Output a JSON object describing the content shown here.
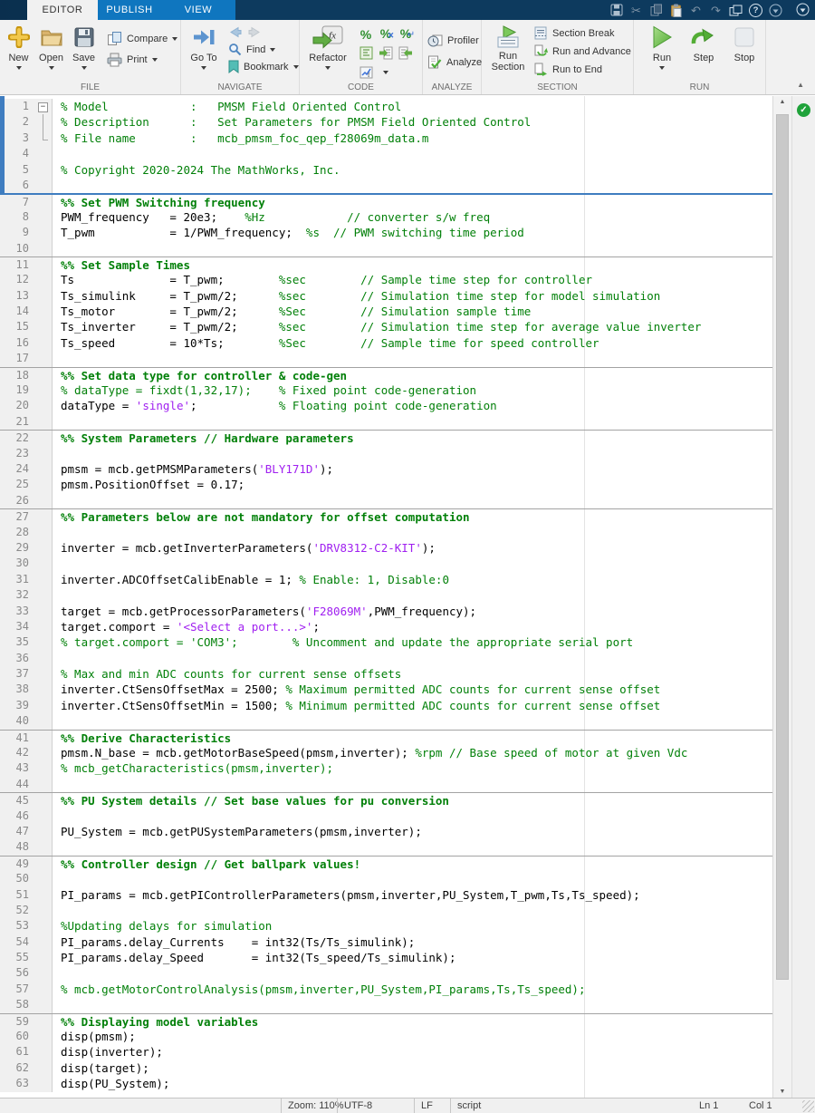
{
  "titlebar": {
    "tabs": [
      {
        "label": "EDITOR",
        "active": true
      },
      {
        "label": "PUBLISH",
        "active": false
      },
      {
        "label": "VIEW",
        "active": false
      }
    ],
    "quick_icons": [
      "save-icon",
      "cut-icon",
      "copy-icon",
      "paste-icon",
      "undo-icon",
      "redo-icon",
      "windows-icon",
      "help-icon",
      "dropdown-icon"
    ],
    "corner_icon": "dropdown-icon"
  },
  "ribbon": {
    "file": {
      "label": "FILE",
      "new": "New",
      "open": "Open",
      "save": "Save",
      "compare": "Compare",
      "print": "Print"
    },
    "navigate": {
      "label": "NAVIGATE",
      "goto": "Go To",
      "find": "Find",
      "bookmark": "Bookmark"
    },
    "code": {
      "label": "CODE",
      "refactor": "Refactor"
    },
    "analyze": {
      "label": "ANALYZE",
      "profiler": "Profiler",
      "analyze": "Analyze"
    },
    "section": {
      "label": "SECTION",
      "run_section_1": "Run",
      "run_section_2": "Section",
      "section_break": "Section Break",
      "run_and_advance": "Run and Advance",
      "run_to_end": "Run to End"
    },
    "run": {
      "label": "RUN",
      "run": "Run",
      "step": "Step",
      "stop": "Stop"
    }
  },
  "colors": {
    "titlebar_navy": "#0d3a5e",
    "tab_blue": "#0f76bf",
    "comment_green": "#028009",
    "string_purple": "#a020f0",
    "section_blue": "#3f7dc0",
    "run_green": "#57b33a",
    "check_green": "#1fa23a"
  },
  "editor": {
    "current_section_lines": 6,
    "lines": [
      {
        "n": 1,
        "f": "box",
        "segs": [
          [
            "c",
            "% Model            :   PMSM Field Oriented Control"
          ]
        ]
      },
      {
        "n": 2,
        "f": "line",
        "segs": [
          [
            "c",
            "% Description      :   Set Parameters for PMSM Field Oriented Control"
          ]
        ]
      },
      {
        "n": 3,
        "f": "end",
        "segs": [
          [
            "c",
            "% File name        :   mcb_pmsm_foc_qep_f28069m_data.m"
          ]
        ]
      },
      {
        "n": 4,
        "segs": []
      },
      {
        "n": 5,
        "segs": [
          [
            "c",
            "% Copyright 2020-2024 The MathWorks, Inc."
          ]
        ]
      },
      {
        "n": 6,
        "segs": []
      },
      {
        "n": 7,
        "sep": "b",
        "segs": [
          [
            "s",
            "%% Set PWM Switching frequency"
          ]
        ]
      },
      {
        "n": 8,
        "segs": [
          [
            "k",
            "PWM_frequency   = 20e3;"
          ],
          [
            "c",
            "    %Hz            // converter s/w freq"
          ]
        ]
      },
      {
        "n": 9,
        "segs": [
          [
            "k",
            "T_pwm           = 1/PWM_frequency;"
          ],
          [
            "c",
            "  %s  // PWM switching time period"
          ]
        ]
      },
      {
        "n": 10,
        "segs": []
      },
      {
        "n": 11,
        "sep": "g",
        "segs": [
          [
            "s",
            "%% Set Sample Times"
          ]
        ]
      },
      {
        "n": 12,
        "segs": [
          [
            "k",
            "Ts              = T_pwm;"
          ],
          [
            "c",
            "        %sec        // Sample time step for controller"
          ]
        ]
      },
      {
        "n": 13,
        "segs": [
          [
            "k",
            "Ts_simulink     = T_pwm/2;"
          ],
          [
            "c",
            "      %sec        // Simulation time step for model simulation"
          ]
        ]
      },
      {
        "n": 14,
        "segs": [
          [
            "k",
            "Ts_motor        = T_pwm/2;"
          ],
          [
            "c",
            "      %Sec        // Simulation sample time"
          ]
        ]
      },
      {
        "n": 15,
        "segs": [
          [
            "k",
            "Ts_inverter     = T_pwm/2;"
          ],
          [
            "c",
            "      %sec        // Simulation time step for average value inverter"
          ]
        ]
      },
      {
        "n": 16,
        "segs": [
          [
            "k",
            "Ts_speed        = 10*Ts;"
          ],
          [
            "c",
            "        %Sec        // Sample time for speed controller"
          ]
        ]
      },
      {
        "n": 17,
        "segs": []
      },
      {
        "n": 18,
        "sep": "g",
        "segs": [
          [
            "s",
            "%% Set data type for controller & code-gen"
          ]
        ]
      },
      {
        "n": 19,
        "segs": [
          [
            "c",
            "% dataType = fixdt(1,32,17);    % Fixed point code-generation"
          ]
        ]
      },
      {
        "n": 20,
        "segs": [
          [
            "k",
            "dataType = "
          ],
          [
            "p",
            "'single'"
          ],
          [
            "k",
            ";"
          ],
          [
            "c",
            "            % Floating point code-generation"
          ]
        ]
      },
      {
        "n": 21,
        "segs": []
      },
      {
        "n": 22,
        "sep": "g",
        "segs": [
          [
            "s",
            "%% System Parameters // Hardware parameters"
          ]
        ]
      },
      {
        "n": 23,
        "segs": []
      },
      {
        "n": 24,
        "segs": [
          [
            "k",
            "pmsm = mcb.getPMSMParameters("
          ],
          [
            "p",
            "'BLY171D'"
          ],
          [
            "k",
            ");"
          ]
        ]
      },
      {
        "n": 25,
        "segs": [
          [
            "k",
            "pmsm.PositionOffset = 0.17;"
          ]
        ]
      },
      {
        "n": 26,
        "segs": []
      },
      {
        "n": 27,
        "sep": "g",
        "segs": [
          [
            "s",
            "%% Parameters below are not mandatory for offset computation"
          ]
        ]
      },
      {
        "n": 28,
        "segs": []
      },
      {
        "n": 29,
        "segs": [
          [
            "k",
            "inverter = mcb.getInverterParameters("
          ],
          [
            "p",
            "'DRV8312-C2-KIT'"
          ],
          [
            "k",
            ");"
          ]
        ]
      },
      {
        "n": 30,
        "segs": []
      },
      {
        "n": 31,
        "segs": [
          [
            "k",
            "inverter.ADCOffsetCalibEnable = 1; "
          ],
          [
            "c",
            "% Enable: 1, Disable:0"
          ]
        ]
      },
      {
        "n": 32,
        "segs": []
      },
      {
        "n": 33,
        "segs": [
          [
            "k",
            "target = mcb.getProcessorParameters("
          ],
          [
            "p",
            "'F28069M'"
          ],
          [
            "k",
            ",PWM_frequency);"
          ]
        ]
      },
      {
        "n": 34,
        "segs": [
          [
            "k",
            "target.comport = "
          ],
          [
            "p",
            "'<Select a port...>'"
          ],
          [
            "k",
            ";"
          ]
        ]
      },
      {
        "n": 35,
        "segs": [
          [
            "c",
            "% target.comport = 'COM3';        % Uncomment and update the appropriate serial port"
          ]
        ]
      },
      {
        "n": 36,
        "segs": []
      },
      {
        "n": 37,
        "segs": [
          [
            "c",
            "% Max and min ADC counts for current sense offsets"
          ]
        ]
      },
      {
        "n": 38,
        "segs": [
          [
            "k",
            "inverter.CtSensOffsetMax = 2500; "
          ],
          [
            "c",
            "% Maximum permitted ADC counts for current sense offset"
          ]
        ]
      },
      {
        "n": 39,
        "segs": [
          [
            "k",
            "inverter.CtSensOffsetMin = 1500; "
          ],
          [
            "c",
            "% Minimum permitted ADC counts for current sense offset"
          ]
        ]
      },
      {
        "n": 40,
        "segs": []
      },
      {
        "n": 41,
        "sep": "g",
        "segs": [
          [
            "s",
            "%% Derive Characteristics"
          ]
        ]
      },
      {
        "n": 42,
        "segs": [
          [
            "k",
            "pmsm.N_base = mcb.getMotorBaseSpeed(pmsm,inverter); "
          ],
          [
            "c",
            "%rpm // Base speed of motor at given Vdc"
          ]
        ]
      },
      {
        "n": 43,
        "segs": [
          [
            "c",
            "% mcb_getCharacteristics(pmsm,inverter);"
          ]
        ]
      },
      {
        "n": 44,
        "segs": []
      },
      {
        "n": 45,
        "sep": "g",
        "segs": [
          [
            "s",
            "%% PU System details // Set base values for pu conversion"
          ]
        ]
      },
      {
        "n": 46,
        "segs": []
      },
      {
        "n": 47,
        "segs": [
          [
            "k",
            "PU_System = mcb.getPUSystemParameters(pmsm,inverter);"
          ]
        ]
      },
      {
        "n": 48,
        "segs": []
      },
      {
        "n": 49,
        "sep": "g",
        "segs": [
          [
            "s",
            "%% Controller design // Get ballpark values!"
          ]
        ]
      },
      {
        "n": 50,
        "segs": []
      },
      {
        "n": 51,
        "segs": [
          [
            "k",
            "PI_params = mcb.getPIControllerParameters(pmsm,inverter,PU_System,T_pwm,Ts,Ts_speed);"
          ]
        ]
      },
      {
        "n": 52,
        "segs": []
      },
      {
        "n": 53,
        "segs": [
          [
            "c",
            "%Updating delays for simulation"
          ]
        ]
      },
      {
        "n": 54,
        "segs": [
          [
            "k",
            "PI_params.delay_Currents    = int32(Ts/Ts_simulink);"
          ]
        ]
      },
      {
        "n": 55,
        "segs": [
          [
            "k",
            "PI_params.delay_Speed       = int32(Ts_speed/Ts_simulink);"
          ]
        ]
      },
      {
        "n": 56,
        "segs": []
      },
      {
        "n": 57,
        "segs": [
          [
            "c",
            "% mcb.getMotorControlAnalysis(pmsm,inverter,PU_System,PI_params,Ts,Ts_speed);"
          ]
        ]
      },
      {
        "n": 58,
        "segs": []
      },
      {
        "n": 59,
        "sep": "g",
        "segs": [
          [
            "s",
            "%% Displaying model variables"
          ]
        ]
      },
      {
        "n": 60,
        "segs": [
          [
            "k",
            "disp(pmsm);"
          ]
        ]
      },
      {
        "n": 61,
        "segs": [
          [
            "k",
            "disp(inverter);"
          ]
        ]
      },
      {
        "n": 62,
        "segs": [
          [
            "k",
            "disp(target);"
          ]
        ]
      },
      {
        "n": 63,
        "segs": [
          [
            "k",
            "disp(PU_System);"
          ]
        ]
      }
    ]
  },
  "statusbar": {
    "zoom": "Zoom: 110%",
    "encoding": "UTF-8",
    "eol": "LF",
    "file_type": "script",
    "line": "Ln  1",
    "col": "Col  1"
  }
}
